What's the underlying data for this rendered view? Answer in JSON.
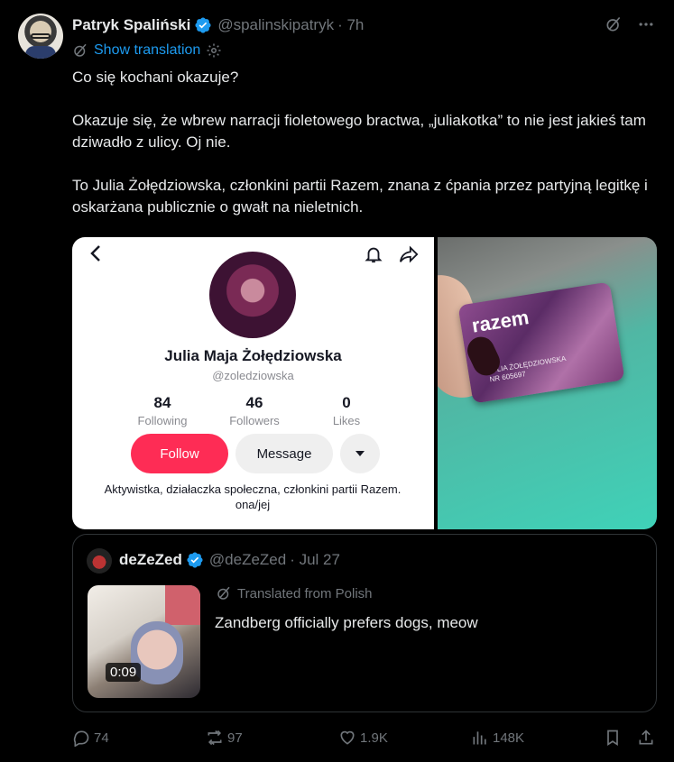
{
  "author": {
    "name": "Patryk Spaliński",
    "handle": "@spalinskipatryk",
    "time": "· 7h"
  },
  "translate_link": "Show translation",
  "post_paragraphs": [
    "Co się kochani okazuje?",
    "Okazuje się, że wbrew narracji fioletowego bractwa, „juliakotka” to nie jest jakieś tam dziwadło z ulicy. Oj nie.",
    "To Julia Żołędziowska, członkini partii Razem, znana z ćpania przez partyjną legitkę i oskarżana publicznie o gwałt na nieletnich."
  ],
  "tiktok_profile": {
    "name": "Julia Maja Żołędziowska",
    "username": "@zoledziowska",
    "stats": [
      {
        "number": "84",
        "label": "Following"
      },
      {
        "number": "46",
        "label": "Followers"
      },
      {
        "number": "0",
        "label": "Likes"
      }
    ],
    "follow_label": "Follow",
    "message_label": "Message",
    "bio_line1": "Aktywistka, działaczka społeczna, członkini partii Razem.",
    "bio_line2": "ona/jej"
  },
  "card_photo": {
    "logo": "razem",
    "holder": "JULIA ŻOŁĘDZIOWSKA",
    "number": "NR 605697"
  },
  "quote": {
    "name": "deZeZed",
    "handle": "@deZeZed",
    "time": "· Jul 27",
    "translated_label": "Translated from Polish",
    "text": "Zandberg officially prefers dogs, meow",
    "duration": "0:09"
  },
  "actions": {
    "replies": "74",
    "reposts": "97",
    "likes": "1.9K",
    "views": "148K"
  },
  "colors": {
    "accent": "#1d9bf0",
    "muted": "#71767b",
    "tiktok_red": "#fe2c55"
  }
}
